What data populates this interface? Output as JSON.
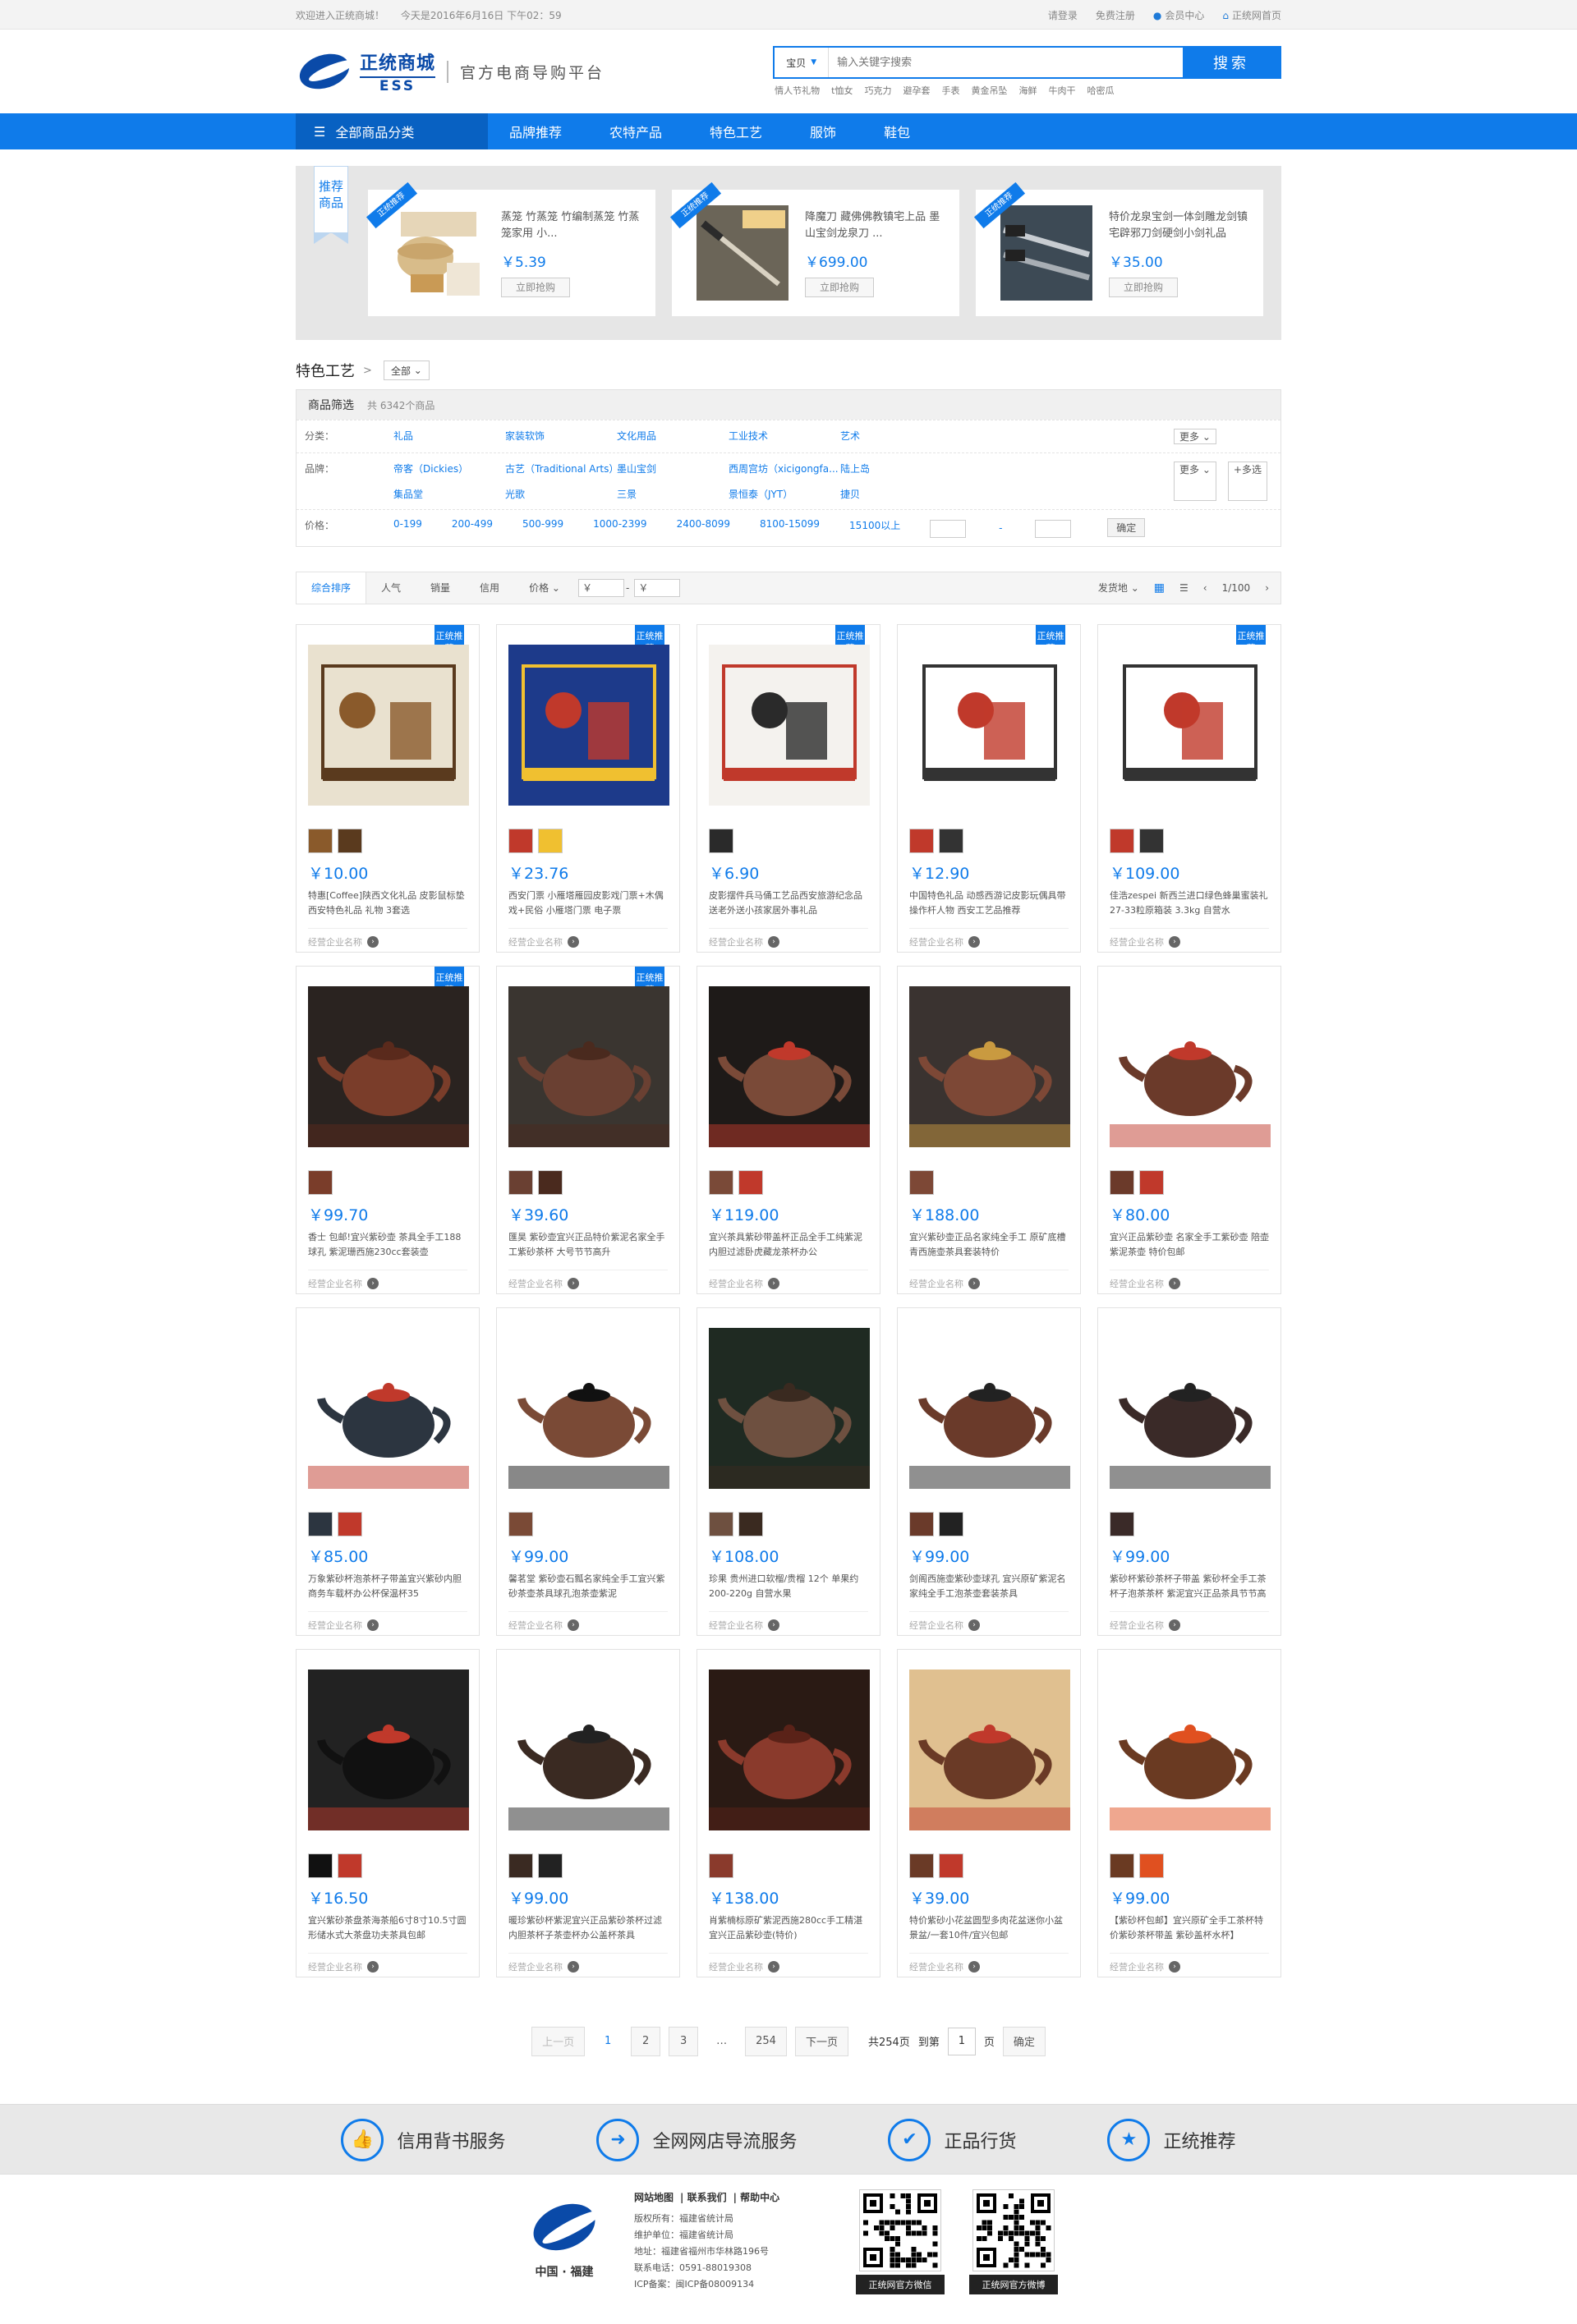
{
  "topbar": {
    "welcome": "欢迎进入正统商城！",
    "today": "今天是2016年6月16日 下午02：59",
    "login": "请登录",
    "register": "免费注册",
    "member": "会员中心",
    "home": "正统网首页"
  },
  "header": {
    "logo_cn": "正统商城",
    "logo_en": "ESS",
    "slogan": "官方电商导购平台",
    "search_type": "宝贝",
    "search_placeholder": "输入关键字搜索",
    "search_button": "搜索",
    "hotwords": [
      "情人节礼物",
      "t恤女",
      "巧克力",
      "避孕套",
      "手表",
      "黄金吊坠",
      "海鲜",
      "牛肉干",
      "哈密瓜"
    ]
  },
  "nav": {
    "all": "全部商品分类",
    "items": [
      "品牌推荐",
      "农特产品",
      "特色工艺",
      "服饰",
      "鞋包"
    ]
  },
  "recommend": {
    "flag": "推荐商品",
    "ribbon": "正统推荐",
    "items": [
      {
        "title": "蒸笼 竹蒸笼 竹编制蒸笼 竹蒸笼家用 小...",
        "price": "￥5.39",
        "btn": "立即抢购"
      },
      {
        "title": "降魔刀 藏佛佛教镇宅上品 墨山宝剑龙泉刀 ...",
        "price": "￥699.00",
        "btn": "立即抢购"
      },
      {
        "title": "特价龙泉宝剑一体剑雕龙剑镇宅辟邪刀剑硬剑小剑礼品",
        "price": "￥35.00",
        "btn": "立即抢购"
      }
    ]
  },
  "category": {
    "title": "特色工艺",
    "arrow": ">",
    "select": "全部"
  },
  "filter": {
    "head": "商品筛选",
    "count": "共 6342个商品",
    "class_label": "分类：",
    "classes": [
      "礼品",
      "家装软饰",
      "文化用品",
      "工业技术",
      "艺术"
    ],
    "brand_label": "品牌：",
    "brands": [
      "帝客（Dickies）",
      "古艺（Traditional Arts）",
      "墨山宝剑",
      "西周宫坊（xicigongfa...",
      "陆上岛",
      "集品堂",
      "光歌",
      "三景",
      "景恒泰（JYT）",
      "捷贝"
    ],
    "more": "更多",
    "multi": "+多选",
    "price_label": "价格：",
    "prices": [
      "0-199",
      "200-499",
      "500-999",
      "1000-2399",
      "2400-8099",
      "8100-15099",
      "15100以上"
    ],
    "price_dash": "-",
    "confirm": "确定"
  },
  "sortbar": {
    "items": [
      "综合排序",
      "人气",
      "销量",
      "信用",
      "价格"
    ],
    "price_from": "￥",
    "price_to": "￥",
    "ship": "发货地",
    "page": "1/100"
  },
  "products": [
    {
      "price": "￥10.00",
      "title": "特惠[Coffee]陕西文化礼品 皮影鼠标垫 西安特色礼品 礼物 3套选",
      "shop": "经营企业名称",
      "badge": true
    },
    {
      "price": "￥23.76",
      "title": "西安门票 小雁塔雁园皮影戏门票+木偶戏+民俗 小雁塔门票 电子票",
      "shop": "经营企业名称",
      "badge": true
    },
    {
      "price": "￥6.90",
      "title": "皮影摆件兵马俑工艺品西安旅游纪念品送老外送小孩家居外事礼品",
      "shop": "经营企业名称",
      "badge": true
    },
    {
      "price": "￥12.90",
      "title": "中国特色礼品 动感西游记皮影玩偶具带操作杆人物 西安工艺品推荐",
      "shop": "经营企业名称",
      "badge": true
    },
    {
      "price": "￥109.00",
      "title": "佳浩zespei 新西兰进口绿色蜂巢蜜装礼 27-33粒原箱装 3.3kg 自营水",
      "shop": "经营企业名称",
      "badge": true
    },
    {
      "price": "￥99.70",
      "title": "香士 包邮!宜兴紫砂壶 茶具全手工188球孔 紫泥珊西施230cc套装壶",
      "shop": "经营企业名称",
      "badge": true
    },
    {
      "price": "￥39.60",
      "title": "匯昊 紫砂壶宜兴正品特价紫泥名家全手工紫砂茶杯 大号节节高升",
      "shop": "经营企业名称",
      "badge": true
    },
    {
      "price": "￥119.00",
      "title": "宜兴茶具紫砂带盖杯正品全手工纯紫泥内胆过滤卧虎藏龙茶杯办公",
      "shop": "经营企业名称",
      "badge": false
    },
    {
      "price": "￥188.00",
      "title": "宜兴紫砂壶正品名家纯全手工 原矿底槽青西施壶茶具套装特价",
      "shop": "经营企业名称",
      "badge": false
    },
    {
      "price": "￥80.00",
      "title": "宜兴正品紫砂壶 名家全手工紫砂壶 陪壶 紫泥茶壶 特价包邮",
      "shop": "经营企业名称",
      "badge": false
    },
    {
      "price": "￥85.00",
      "title": "万象紫砂杯泡茶杯子带盖宜兴紫砂内胆商务车载杯办公杯保温杯35",
      "shop": "经营企业名称",
      "badge": false
    },
    {
      "price": "￥99.00",
      "title": "馨茗堂 紫砂壶石瓢名家纯全手工宜兴紫砂茶壶茶具球孔泡茶壶紫泥",
      "shop": "经营企业名称",
      "badge": false
    },
    {
      "price": "￥108.00",
      "title": "珍果 贵州进口软榴/贵榴 12个 单果约200-220g 自营水果",
      "shop": "经营企业名称",
      "badge": false
    },
    {
      "price": "￥99.00",
      "title": "剑阁西施壶紫砂壶球孔 宜兴原矿紫泥名家纯全手工泡茶壶套装茶具",
      "shop": "经营企业名称",
      "badge": false
    },
    {
      "price": "￥99.00",
      "title": "紫砂杯紫砂茶杯子带盖 紫砂杯全手工茶杯子泡茶茶杯 紫泥宜兴正品茶具节节高升",
      "shop": "经营企业名称",
      "badge": false
    },
    {
      "price": "￥16.50",
      "title": "宜兴紫砂茶盘茶海茶船6寸8寸10.5寸圆形储水式大茶盘功夫茶具包邮",
      "shop": "经营企业名称",
      "badge": false
    },
    {
      "price": "￥99.00",
      "title": "暖珍紫砂杯紫泥宜兴正品紫砂茶杯过滤内胆茶杯子茶壶杯办公盖杯茶具",
      "shop": "经营企业名称",
      "badge": false
    },
    {
      "price": "￥138.00",
      "title": "肖紫楠标原矿紫泥西施280cc手工精湛宜兴正品紫砂壶(特价)",
      "shop": "经营企业名称",
      "badge": false
    },
    {
      "price": "￥39.00",
      "title": "特价紫砂小花盆圆型多肉花盆迷你小盆景盆/一套10件/宜兴包邮",
      "shop": "经营企业名称",
      "badge": false
    },
    {
      "price": "￥99.00",
      "title": "【紫砂杯包邮】宜兴原矿全手工茶杯特价紫砂茶杯带盖 紫砂盖杯水杯】",
      "shop": "经营企业名称",
      "badge": false
    }
  ],
  "badge_text": "正统推荐",
  "pager": {
    "prev": "上一页",
    "pages": [
      "1",
      "2",
      "3"
    ],
    "ellipsis": "…",
    "last": "254",
    "next": "下一页",
    "total": "共254页",
    "goto": "到第",
    "current_input": "1",
    "unit": "页",
    "confirm": "确定"
  },
  "services": [
    {
      "icon": "thumbs-up-icon",
      "glyph": "👍",
      "label": "信用背书服务"
    },
    {
      "icon": "arrow-right-icon",
      "glyph": "➜",
      "label": "全网网店导流服务"
    },
    {
      "icon": "shield-icon",
      "glyph": "✔",
      "label": "正品行货"
    },
    {
      "icon": "star-icon",
      "glyph": "★",
      "label": "正统推荐"
    }
  ],
  "footer": {
    "caption": "中国 · 福建",
    "links": [
      "网站地图",
      "联系我们",
      "帮助中心"
    ],
    "lines": [
      "版权所有：福建省统计局",
      "维护单位：福建省统计局",
      "地址：福建省福州市华林路196号",
      "联系电话：0591-88019308",
      "ICP备案：闽ICP备08009134"
    ],
    "qr1": "正统网官方微信",
    "qr2": "正统网官方微博"
  }
}
